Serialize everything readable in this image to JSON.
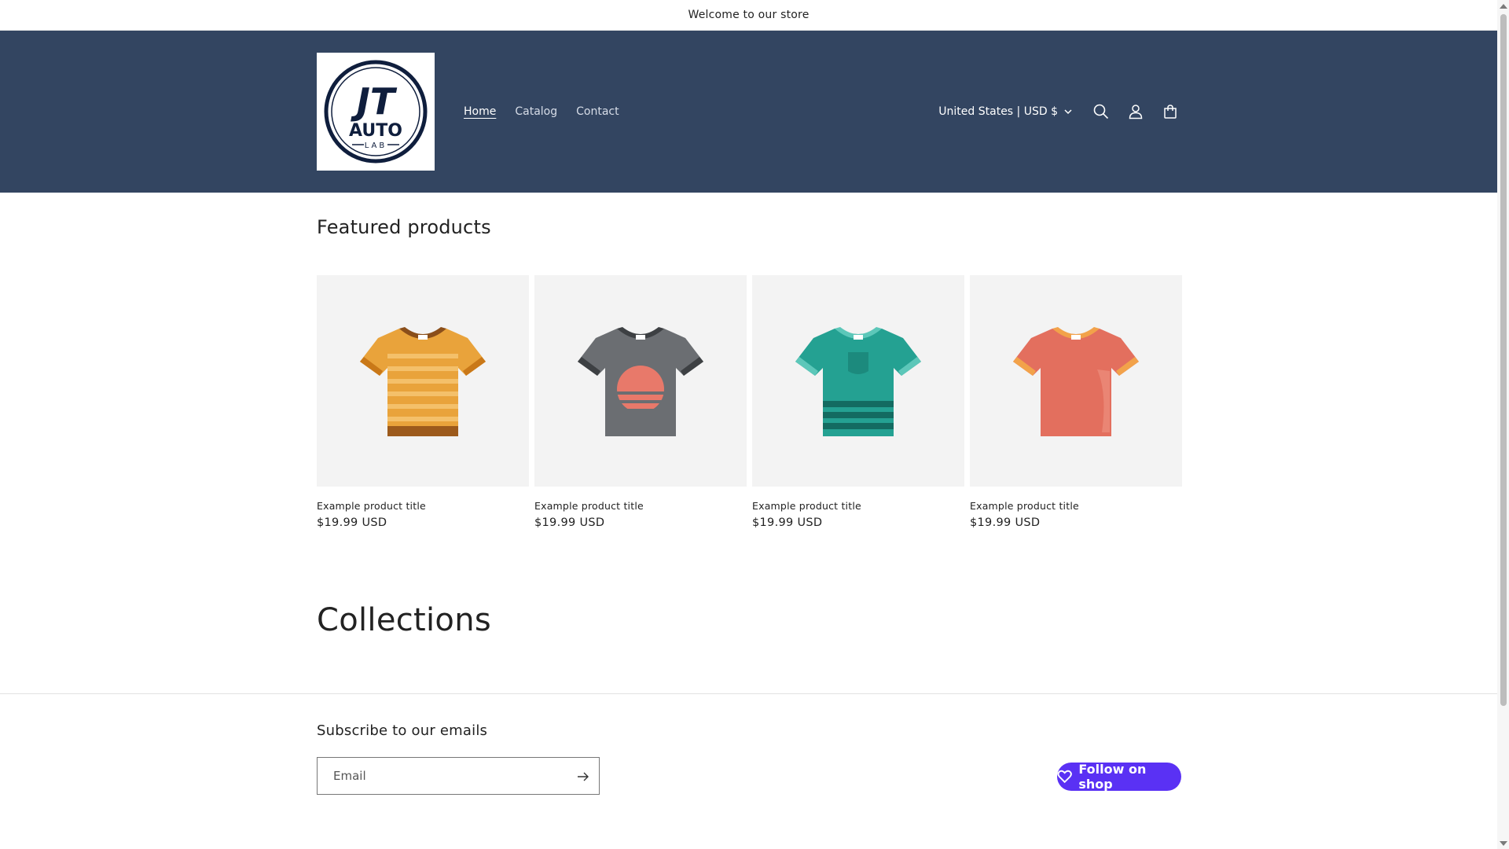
{
  "announcement": {
    "text": "Welcome to our store"
  },
  "header": {
    "logo": {
      "line1": "JT",
      "line2": "AUTO",
      "line3": "LAB",
      "icon": "jt-auto-lab-logo"
    },
    "nav": [
      {
        "label": "Home",
        "active": true
      },
      {
        "label": "Catalog",
        "active": false
      },
      {
        "label": "Contact",
        "active": false
      }
    ],
    "currency": "United States | USD $",
    "icons": [
      "search-icon",
      "account-icon",
      "cart-icon"
    ],
    "background": "#334561"
  },
  "featured": {
    "heading": "Featured products",
    "products": [
      {
        "title": "Example product title",
        "price": "$19.99 USD",
        "shirt": "striped-orange"
      },
      {
        "title": "Example product title",
        "price": "$19.99 USD",
        "shirt": "gray-sunset"
      },
      {
        "title": "Example product title",
        "price": "$19.99 USD",
        "shirt": "teal-pocket"
      },
      {
        "title": "Example product title",
        "price": "$19.99 USD",
        "shirt": "coral-plain"
      }
    ]
  },
  "collections": {
    "heading": "Collections"
  },
  "footer": {
    "subscribe_title": "Subscribe to our emails",
    "email_placeholder": "Email",
    "follow_label": "Follow on shop",
    "follow_color": "#5a31f4"
  }
}
